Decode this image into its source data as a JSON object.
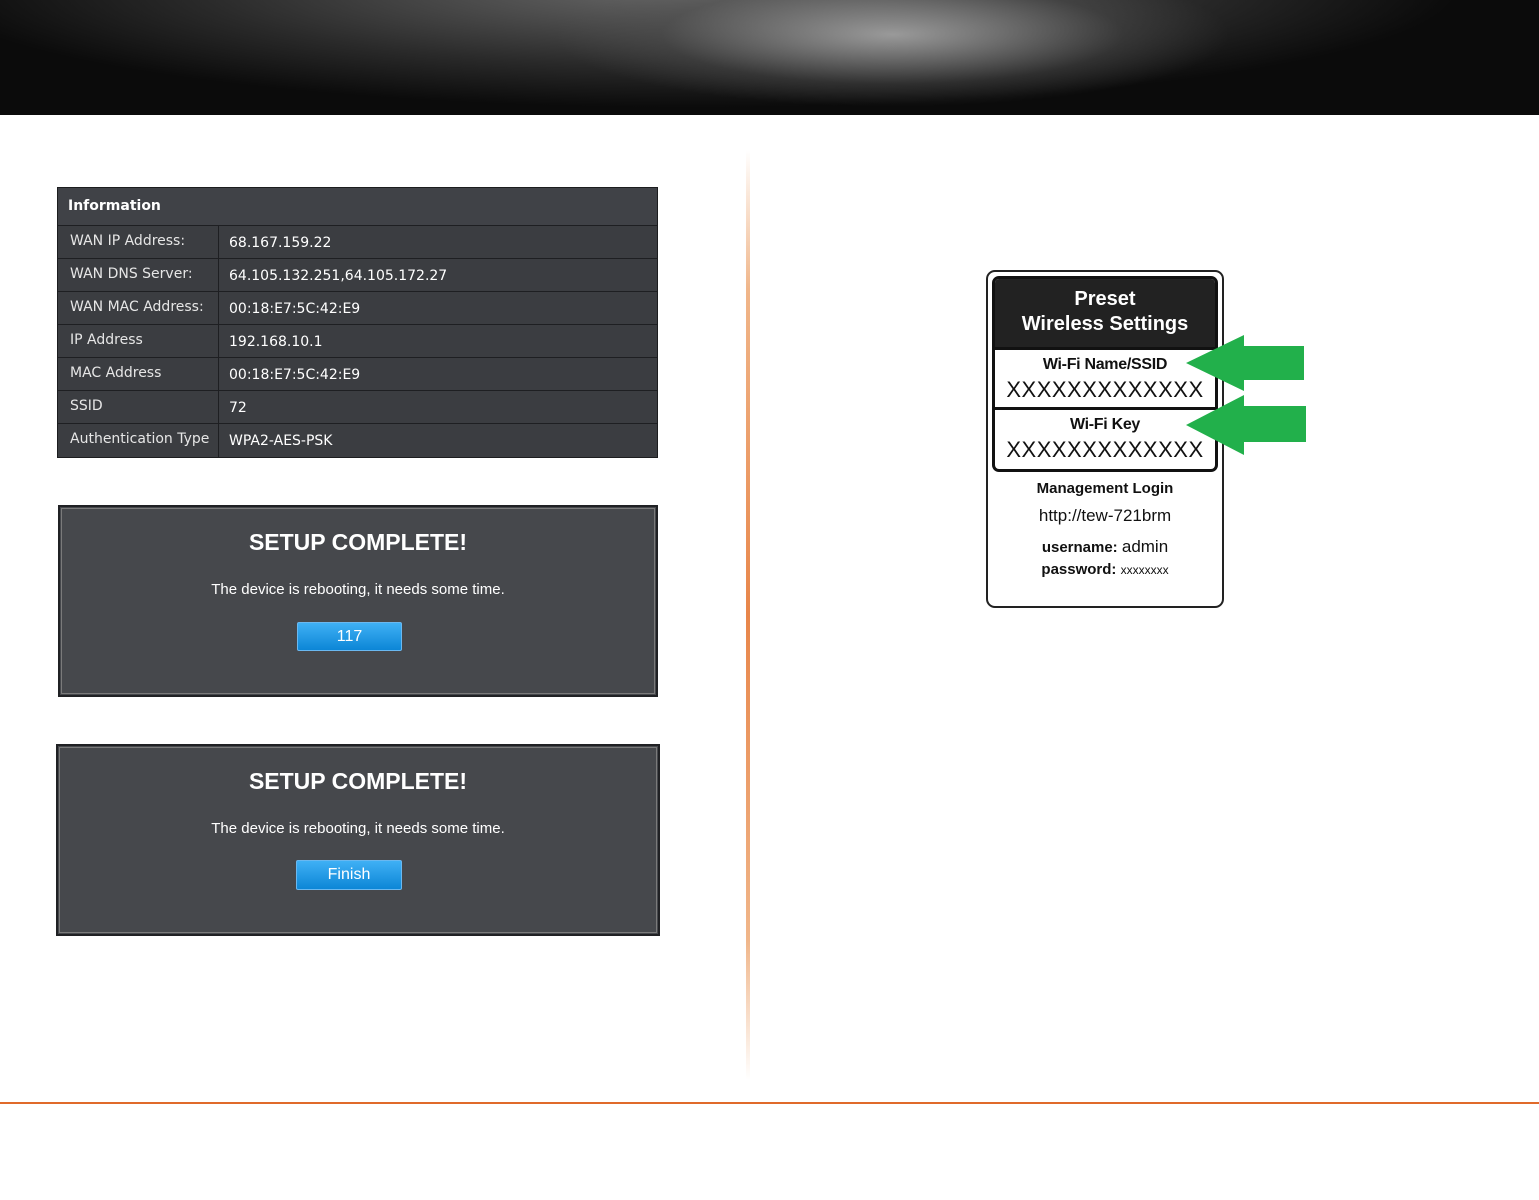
{
  "info_table": {
    "header": "Information",
    "rows": [
      {
        "label": "WAN IP Address:",
        "value": "68.167.159.22"
      },
      {
        "label": "WAN DNS Server:",
        "value": "64.105.132.251,64.105.172.27"
      },
      {
        "label": "WAN MAC Address:",
        "value": "00:18:E7:5C:42:E9"
      },
      {
        "label": "IP Address",
        "value": "192.168.10.1"
      },
      {
        "label": "MAC Address",
        "value": "00:18:E7:5C:42:E9"
      },
      {
        "label": "SSID",
        "value": "72"
      },
      {
        "label": "Authentication Type",
        "value": "WPA2-AES-PSK"
      }
    ]
  },
  "setup_panel_1": {
    "title": "SETUP COMPLETE!",
    "message": "The device is rebooting, it needs some time.",
    "countdown": "117"
  },
  "setup_panel_2": {
    "title": "SETUP COMPLETE!",
    "message": "The device is rebooting, it needs some time.",
    "button": "Finish"
  },
  "label": {
    "title_line1": "Preset",
    "title_line2": "Wireless Settings",
    "ssid_title": "Wi-Fi Name/SSID",
    "ssid_value": "XXXXXXXXXXXXX",
    "key_title": "Wi-Fi Key",
    "key_value": "XXXXXXXXXXXXX",
    "mgmt_title": "Management Login",
    "mgmt_url": "http://tew-721brm",
    "username_label": "username:",
    "username_value": "admin",
    "password_label": "password:",
    "password_value": "xxxxxxxx"
  },
  "colors": {
    "accent_orange": "#e06a2a",
    "arrow_green": "#22b04b",
    "button_blue": "#0c86d6",
    "panel_bg": "#46484c"
  }
}
